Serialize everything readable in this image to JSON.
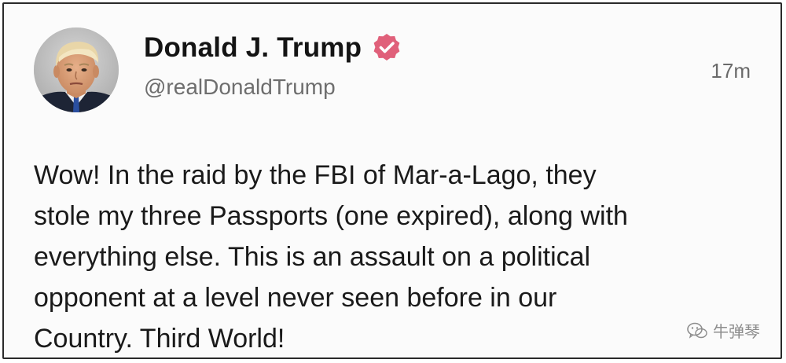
{
  "post": {
    "display_name": "Donald J. Trump",
    "handle": "@realDonaldTrump",
    "timestamp": "17m",
    "verified_icon": "verified-badge-icon",
    "verified_color": "#e0607a",
    "body_lines": [
      "Wow! In the raid by the FBI of Mar-a-Lago, they",
      "stole my three Passports (one expired), along with",
      "everything else. This is an assault on a political",
      "opponent at a level never seen before in our",
      "Country. Third World!"
    ]
  },
  "watermark": {
    "icon": "wechat-logo-icon",
    "text": "牛弹琴"
  }
}
